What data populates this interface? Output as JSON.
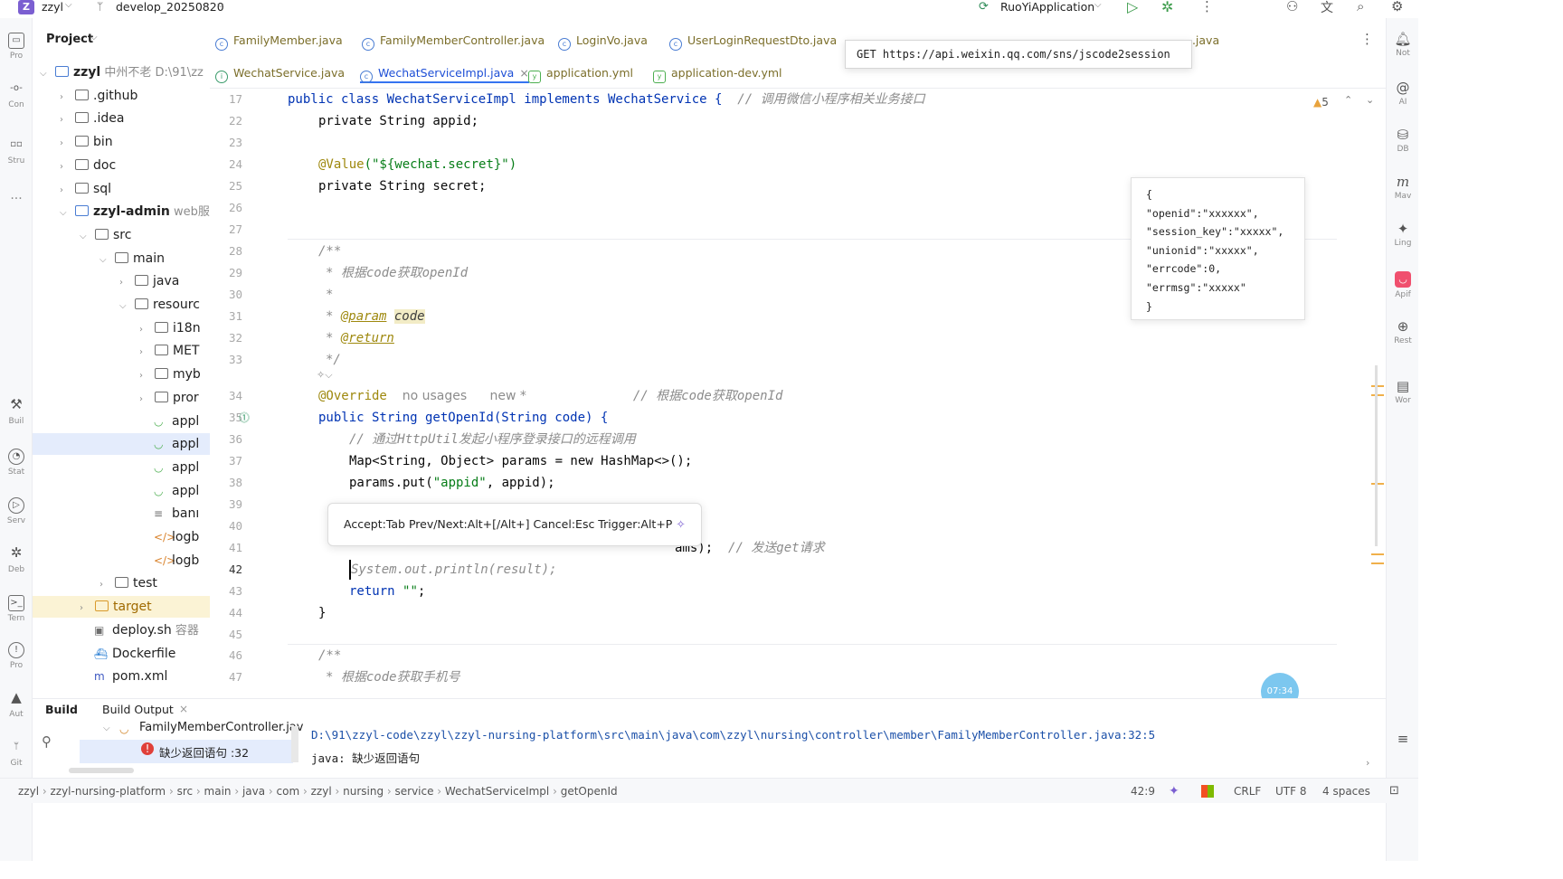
{
  "titlebar": {
    "project_badge": "Z",
    "project_name": "zzyl",
    "branch": "develop_20250820",
    "run_config": "RuoYiApplication"
  },
  "left_strip": {
    "items": [
      "Pro",
      "Con",
      "Stru",
      "...",
      "Buil",
      "Stat",
      "Serv",
      "Deb",
      "Tern",
      "Pro",
      "Aut",
      "Git"
    ]
  },
  "project_panel": {
    "title": "Project",
    "tree": [
      {
        "label": "zzyl",
        "extra": "中州不老 D:\\91\\zz",
        "depth": 0,
        "expanded": true,
        "type": "module"
      },
      {
        "label": ".github",
        "depth": 1,
        "type": "folder"
      },
      {
        "label": ".idea",
        "depth": 1,
        "type": "folder"
      },
      {
        "label": "bin",
        "depth": 1,
        "type": "folder"
      },
      {
        "label": "doc",
        "depth": 1,
        "type": "folder"
      },
      {
        "label": "sql",
        "depth": 1,
        "type": "folder"
      },
      {
        "label": "zzyl-admin",
        "extra": "web服",
        "depth": 1,
        "expanded": true,
        "type": "module"
      },
      {
        "label": "src",
        "depth": 2,
        "expanded": true,
        "type": "folder"
      },
      {
        "label": "main",
        "depth": 3,
        "expanded": true,
        "type": "folder"
      },
      {
        "label": "java",
        "depth": 4,
        "type": "folder"
      },
      {
        "label": "resourc",
        "depth": 4,
        "expanded": true,
        "type": "folder"
      },
      {
        "label": "i18n",
        "depth": 5,
        "type": "folder"
      },
      {
        "label": "MET",
        "depth": 5,
        "type": "folder"
      },
      {
        "label": "myb",
        "depth": 5,
        "type": "folder"
      },
      {
        "label": "pror",
        "depth": 5,
        "type": "folder"
      },
      {
        "label": "appl",
        "depth": 5,
        "type": "yml"
      },
      {
        "label": "appl",
        "depth": 5,
        "type": "yml",
        "selected": true
      },
      {
        "label": "appl",
        "depth": 5,
        "type": "yml"
      },
      {
        "label": "appl",
        "depth": 5,
        "type": "yml"
      },
      {
        "label": "banı",
        "depth": 5,
        "type": "txt"
      },
      {
        "label": "logb",
        "depth": 5,
        "type": "xml"
      },
      {
        "label": "logb",
        "depth": 5,
        "type": "xml"
      },
      {
        "label": "test",
        "depth": 3,
        "type": "folder"
      },
      {
        "label": "target",
        "depth": 2,
        "type": "folder",
        "highlight": true
      },
      {
        "label": "deploy.sh",
        "extra": "容器",
        "depth": 2,
        "type": "sh"
      },
      {
        "label": "Dockerfile",
        "depth": 2,
        "type": "docker"
      },
      {
        "label": "pom.xml",
        "depth": 2,
        "type": "maven"
      }
    ]
  },
  "tabs_row1": [
    {
      "label": "FamilyMember.java"
    },
    {
      "label": "FamilyMemberController.java"
    },
    {
      "label": "LoginVo.java"
    },
    {
      "label": "UserLoginRequestDto.java"
    },
    {
      "label": "...java"
    }
  ],
  "tabs_row2": [
    {
      "label": "WechatService.java"
    },
    {
      "label": "WechatServiceImpl.java",
      "active": true,
      "close": "×"
    },
    {
      "label": "application.yml"
    },
    {
      "label": "application-dev.yml"
    }
  ],
  "tooltip_url": "GET https://api.weixin.qq.com/sns/jscode2session",
  "json_popup": [
    "{",
    "\"openid\":\"xxxxxx\",",
    "\"session_key\":\"xxxxx\",",
    "\"unionid\":\"xxxxx\",",
    "\"errcode\":0,",
    "\"errmsg\":\"xxxxx\"",
    "}"
  ],
  "warnings": {
    "count": "5"
  },
  "editor": {
    "line_numbers": [
      "17",
      "22",
      "23",
      "24",
      "25",
      "26",
      "27",
      "28",
      "29",
      "30",
      "31",
      "32",
      "33",
      "",
      "34",
      "35",
      "36",
      "37",
      "38",
      "39",
      "40",
      "41",
      "42",
      "43",
      "44",
      "45",
      "46",
      "47"
    ],
    "line_17": {
      "code": "public class WechatServiceImpl implements WechatService {",
      "comment": "// 调用微信小程序相关业务接口"
    },
    "line_22": "private String appid;",
    "line_24_ann": "@Value",
    "line_24_str": "(\"${wechat.secret}\")",
    "line_25": "private String secret;",
    "line_28": "/**",
    "line_29": "* 根据code获取openId",
    "line_30": "*",
    "line_31_tag": "@param",
    "line_31_val": "code",
    "line_32_tag": "@return",
    "line_33": "*/",
    "line_34_ann": "@Override",
    "line_34_usage": "no usages",
    "line_34_new": "new *",
    "line_34_comment": "// 根据code获取openId",
    "line_35": "public String getOpenId(String code) {",
    "line_36": "// 通过HttpUtil发起小程序登录接口的远程调用",
    "line_37": "Map<String, Object> params = new HashMap<>();",
    "line_38_a": "params.put(",
    "line_38_b": "\"appid\"",
    "line_38_c": ", appid);",
    "line_41_a": "ams);",
    "line_41_comment": "// 发送get请求",
    "line_42": "System.out.println(result);",
    "line_43_kw": "return",
    "line_43_str": "\"\"",
    "line_43_end": ";",
    "line_44": "}",
    "line_46": "/**",
    "line_47": "* 根据code获取手机号"
  },
  "completion_hint": "Accept:Tab Prev/Next:Alt+[/Alt+] Cancel:Esc Trigger:Alt+P",
  "timer_badge": "07:34",
  "right_strip": {
    "items": [
      "Not",
      "AI",
      "DB",
      "Mav",
      "Ling",
      "Apif",
      "Rest",
      "Wor"
    ]
  },
  "build": {
    "tab_build": "Build",
    "tab_output": "Build Output",
    "close": "×",
    "tree_file": "FamilyMemberController.jav",
    "error_text": "缺少返回语句 :32",
    "output_path": "D:\\91\\zzyl-code\\zzyl\\zzyl-nursing-platform\\src\\main\\java\\com\\zzyl\\nursing\\controller\\member\\FamilyMemberController.java:32:5",
    "output_msg": "java: 缺少返回语句"
  },
  "statusbar": {
    "crumbs": [
      "zzyl",
      "zzyl-nursing-platform",
      "src",
      "main",
      "java",
      "com",
      "zzyl",
      "nursing",
      "service",
      "WechatServiceImpl",
      "getOpenId"
    ],
    "position": "42:9",
    "line_sep": "CRLF",
    "encoding": "UTF 8",
    "indent": "4 spaces"
  }
}
